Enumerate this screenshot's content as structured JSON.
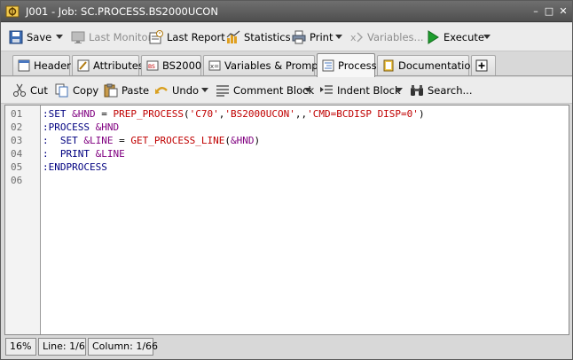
{
  "window": {
    "title": "J001 - Job: SC.PROCESS.BS2000UCON",
    "min_glyph": "–",
    "max_glyph": "□",
    "close_glyph": "✕"
  },
  "toolbar": {
    "save": "Save",
    "last_monitor": "Last Monitor",
    "last_report": "Last Report",
    "statistics": "Statistics",
    "print": "Print",
    "variables": "Variables...",
    "execute": "Execute"
  },
  "tabs": [
    {
      "label": "Header",
      "icon": "header-icon"
    },
    {
      "label": "Attributes",
      "icon": "attributes-icon"
    },
    {
      "label": "BS2000",
      "icon": "bs2000-icon"
    },
    {
      "label": "Variables & Prompts",
      "icon": "variables-icon"
    },
    {
      "label": "Process",
      "icon": "process-icon",
      "active": true
    },
    {
      "label": "Documentation",
      "icon": "documentation-icon"
    },
    {
      "label": "",
      "icon": "add-tab-icon"
    }
  ],
  "edit_toolbar": {
    "cut": "Cut",
    "copy": "Copy",
    "paste": "Paste",
    "undo": "Undo",
    "comment_block": "Comment Block",
    "indent_block": "Indent Block",
    "search": "Search..."
  },
  "editor": {
    "line_numbers": [
      "01",
      "02",
      "03",
      "04",
      "05",
      "06"
    ],
    "lines": [
      ":SET &HND = PREP_PROCESS('C70','BS2000UCON',,'CMD=BCDISP DISP=0')",
      ":PROCESS &HND",
      ":  SET &LINE = GET_PROCESS_LINE(&HND)",
      ":  PRINT &LINE",
      ":ENDPROCESS",
      ""
    ]
  },
  "status": {
    "zoom": "16%",
    "line": "Line: 1/6",
    "column": "Column: 1/66"
  },
  "colors": {
    "keyword": "#000080",
    "variable": "#800080",
    "function": "#c00000",
    "string": "#c00000",
    "execute_green": "#1e9e2e"
  }
}
